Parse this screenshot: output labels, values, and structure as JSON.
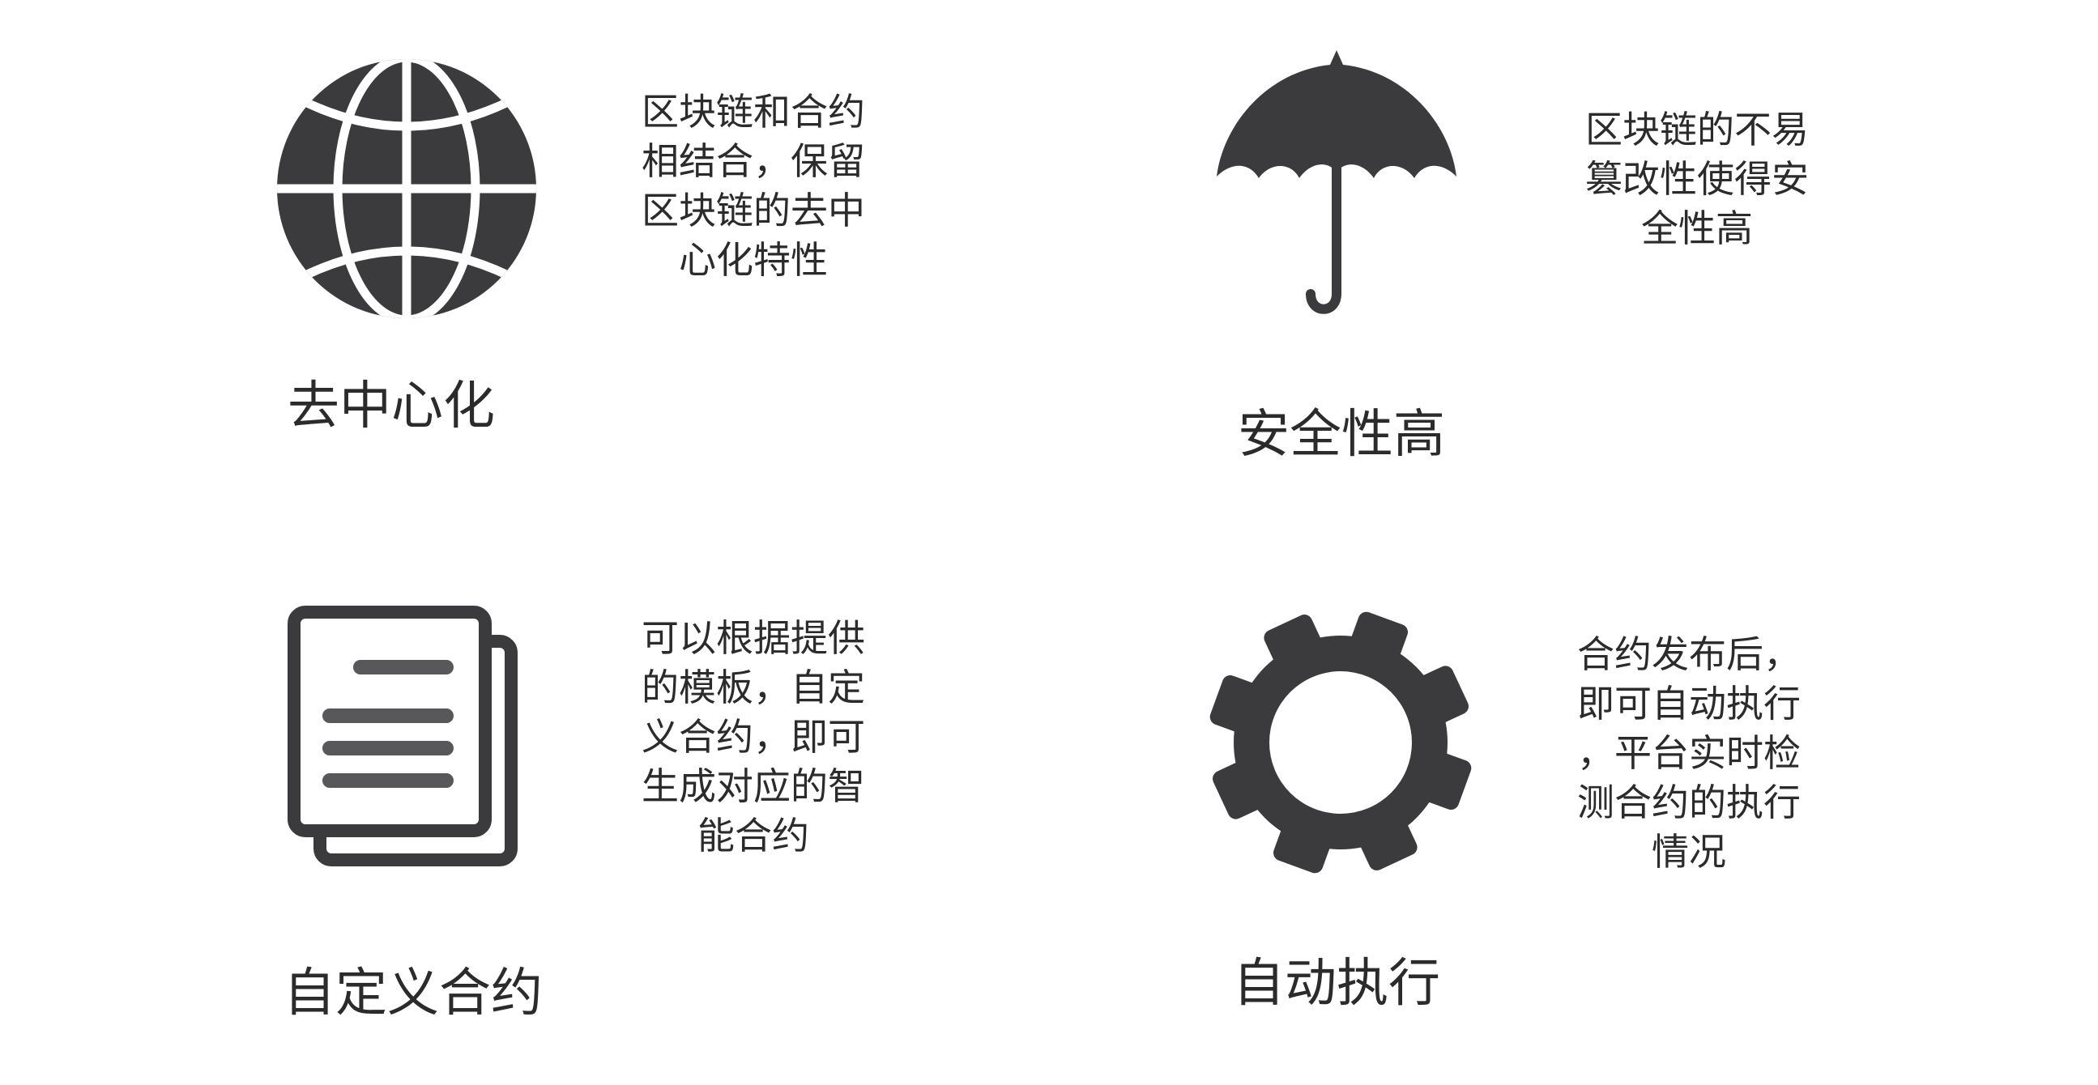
{
  "colors": {
    "icon": "#3b3b3d",
    "text": "#2b2b2b",
    "background": "#ffffff"
  },
  "features": [
    {
      "icon": "globe-icon",
      "title": "去中心化",
      "description_lines": [
        "区块链和合约",
        "相结合，保留",
        "区块链的去中",
        "心化特性"
      ]
    },
    {
      "icon": "umbrella-icon",
      "title": "安全性高",
      "description_lines": [
        "区块链的不易",
        "篡改性使得安",
        "全性高"
      ]
    },
    {
      "icon": "document-icon",
      "title": "自定义合约",
      "description_lines": [
        "可以根据提供",
        "的模板，自定",
        "义合约，即可",
        "生成对应的智",
        "能合约"
      ]
    },
    {
      "icon": "gear-icon",
      "title": "自动执行",
      "description_lines": [
        "合约发布后，",
        "即可自动执行",
        "，平台实时检",
        "测合约的执行",
        "情况"
      ]
    }
  ]
}
